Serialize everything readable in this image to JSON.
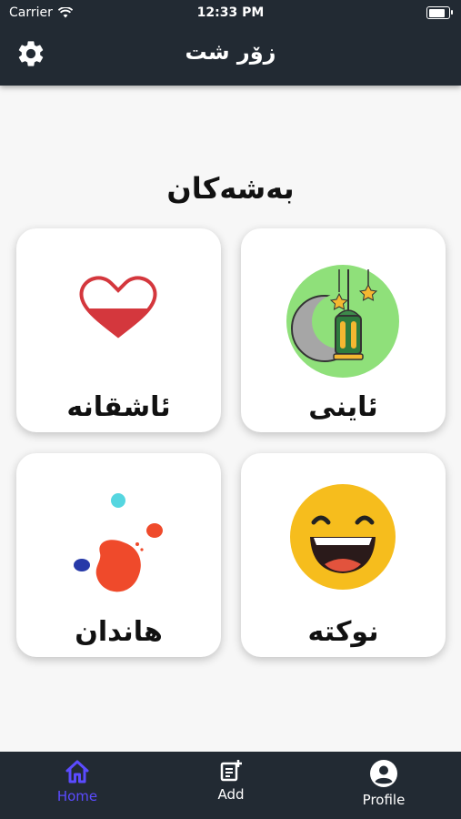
{
  "status_bar": {
    "carrier": "Carrier",
    "time": "12:33 PM"
  },
  "header": {
    "title": "زۆر شت"
  },
  "section": {
    "title": "بەشەکان"
  },
  "cards": [
    {
      "label": "ئاشقانە",
      "icon": "heart-icon"
    },
    {
      "label": "ئاینی",
      "icon": "crescent-lantern-icon"
    },
    {
      "label": "هاندان",
      "icon": "paint-splash-icon"
    },
    {
      "label": "نوکتە",
      "icon": "laughing-face-icon"
    }
  ],
  "tabs": [
    {
      "label": "Home",
      "icon": "home-icon",
      "active": true
    },
    {
      "label": "Add",
      "icon": "add-note-icon",
      "active": false
    },
    {
      "label": "Profile",
      "icon": "profile-icon",
      "active": false
    }
  ],
  "colors": {
    "bar": "#222a33",
    "active_tab": "#5b4bff",
    "background": "#f7f7f7"
  }
}
